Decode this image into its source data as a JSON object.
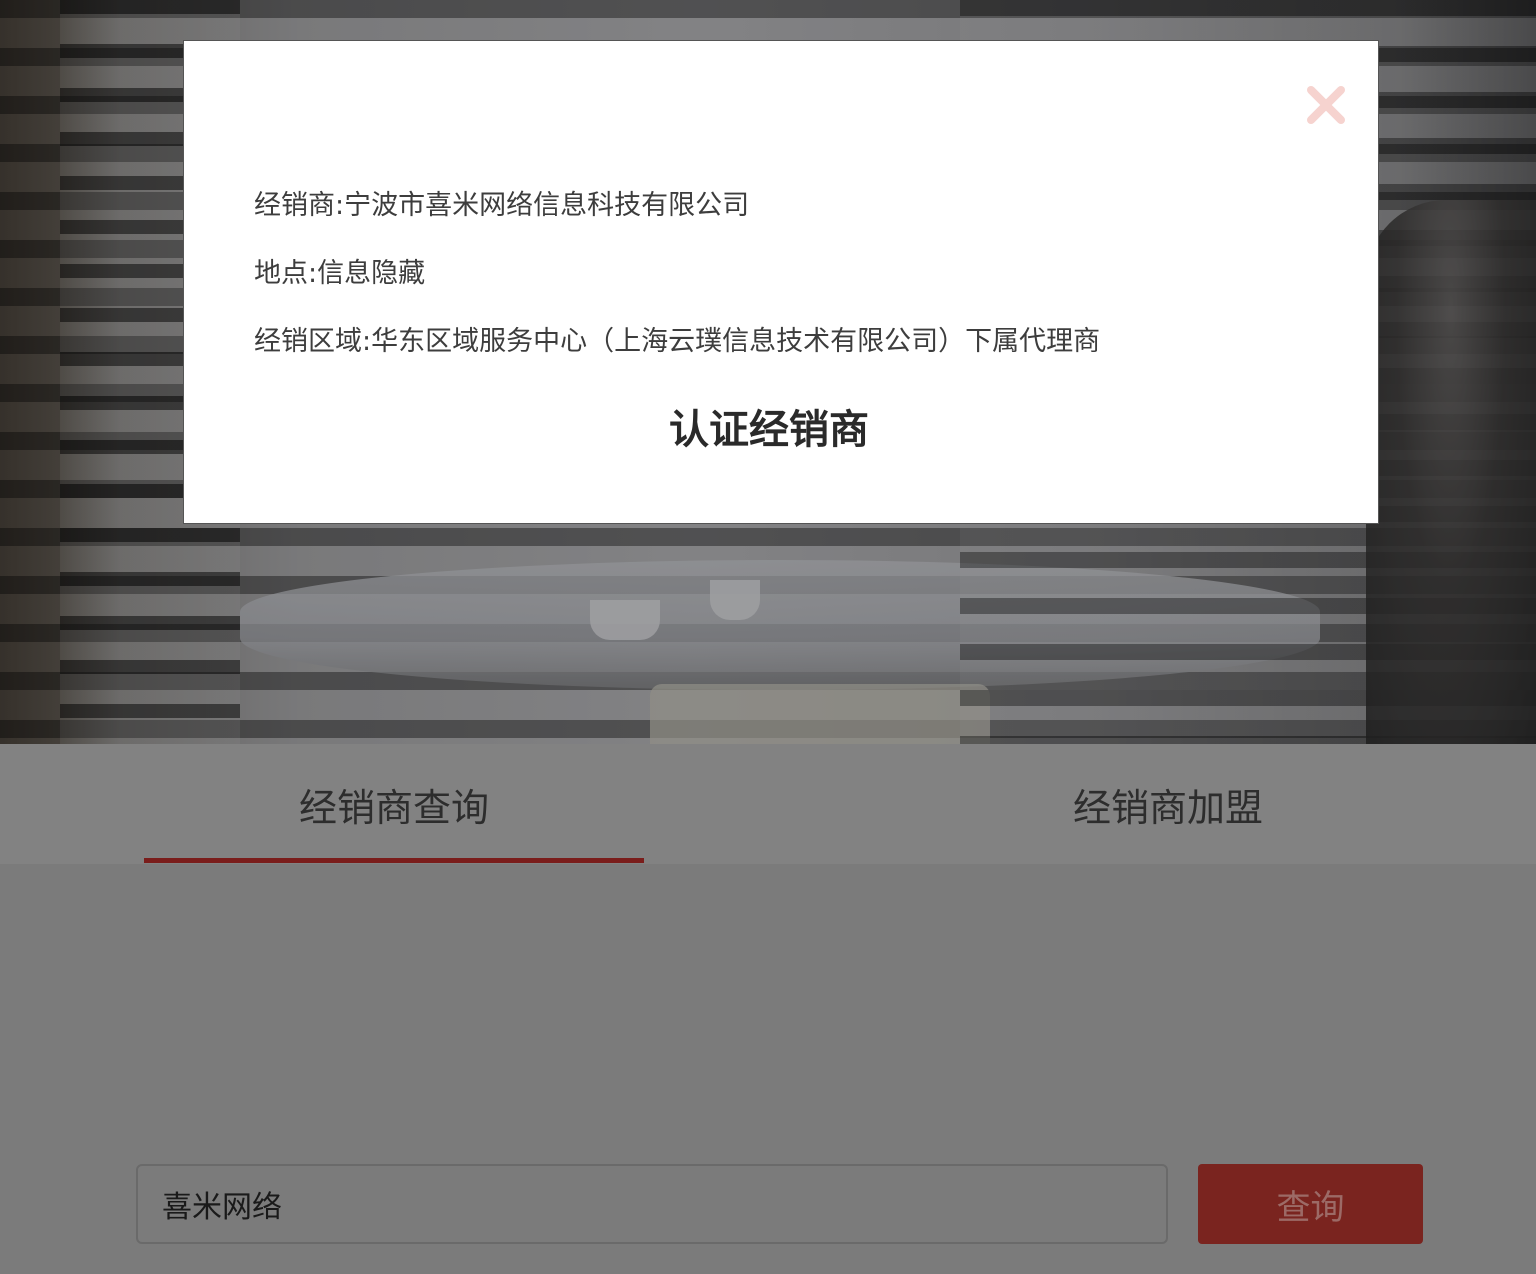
{
  "tabs": {
    "query_label": "经销商查询",
    "join_label": "经销商加盟"
  },
  "search": {
    "value": "喜米网络",
    "button_label": "查询"
  },
  "modal": {
    "line1": "经销商:宁波市喜米网络信息科技有限公司",
    "line2": "地点:信息隐藏",
    "line3": "经销区域:华东区域服务中心（上海云璞信息技术有限公司）下属代理商",
    "title": "认证经销商",
    "close_icon": "close-icon"
  },
  "colors": {
    "accent": "#7a1d1b",
    "close": "#f6d3cf"
  }
}
